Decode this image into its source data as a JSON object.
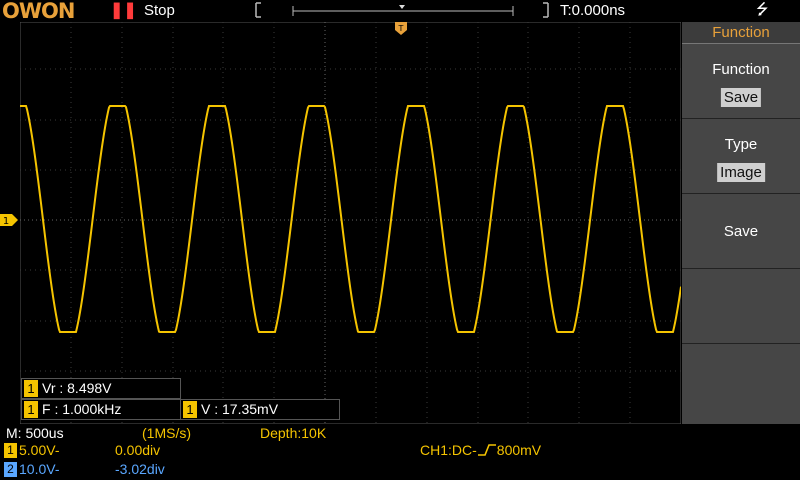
{
  "topbar": {
    "logo": "OWON",
    "run_state_icon": "pause-icon",
    "status": "Stop",
    "trigger_time": "T:0.000ns",
    "usb_icon": "usb-icon"
  },
  "menu": {
    "title": "Function",
    "items": [
      {
        "label": "Function",
        "value": "Save"
      },
      {
        "label": "Type",
        "value": "Image"
      },
      {
        "label": "Save",
        "value": ""
      },
      {
        "label": "",
        "value": ""
      },
      {
        "label": "",
        "value": ""
      }
    ]
  },
  "measurements": {
    "vr": {
      "channel": "1",
      "text": "Vr : 8.498V"
    },
    "f": {
      "channel": "1",
      "text": "F : 1.000kHz"
    },
    "v": {
      "channel": "1",
      "text": "V : 17.35mV"
    }
  },
  "status_bar": {
    "timebase": "M: 500us",
    "sample_rate": "(1MS/s)",
    "depth": "Depth:10K",
    "ch1": {
      "badge": "1",
      "scale": "5.00V-",
      "offset": "0.00div"
    },
    "ch2": {
      "badge": "2",
      "scale": "10.0V-",
      "offset": "-3.02div"
    },
    "trigger": "CH1:DC-",
    "trigger_level": "800mV"
  },
  "waveform": {
    "channel": "1",
    "color": "#f5c400",
    "shape": "sine",
    "cycles_visible": 6.5
  },
  "colors": {
    "ch1": "#f5c400",
    "ch2": "#5aa7ff",
    "accent": "#e8a13a"
  }
}
